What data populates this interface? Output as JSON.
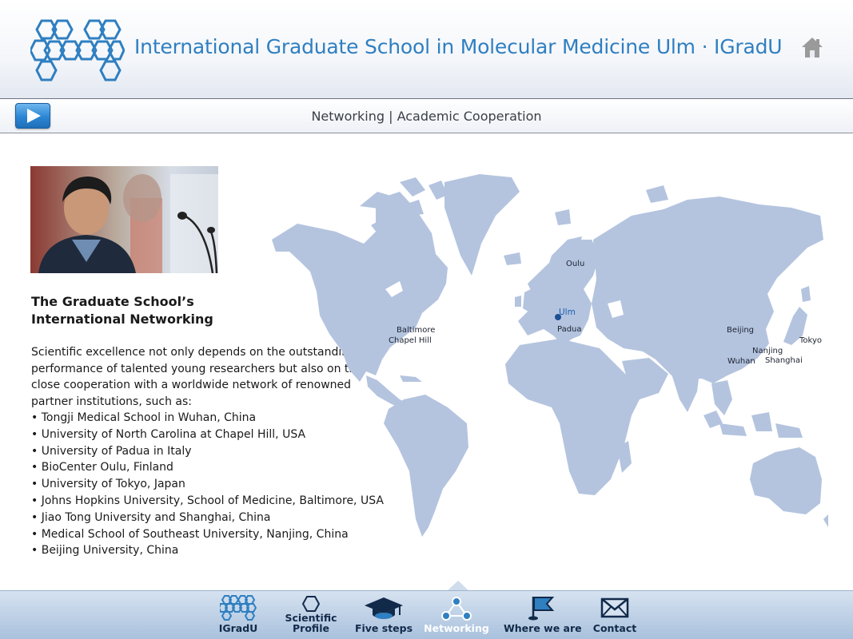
{
  "header": {
    "title": "International Graduate School in Molecular Medicine Ulm · IGradU",
    "logo_icon": "hexagon-logo-icon",
    "home_icon": "home-icon"
  },
  "subbar": {
    "play_icon": "play-icon",
    "breadcrumb": "Networking | Academic Cooperation"
  },
  "content": {
    "heading_line1": "The Graduate School’s",
    "heading_line2": "International Networking",
    "intro": "Scientific excellence not only depends on the outstanding performance of talented young researchers but also on the close cooperation with a worldwide network of renowned partner institutions, such as:",
    "partners": [
      "Tongji Medical School in Wuhan, China",
      "University of North Carolina at Chapel Hill, USA",
      "University of Padua in Italy",
      "BioCenter Oulu, Finland",
      "University of Tokyo, Japan",
      "Johns Hopkins University, School of Medicine, Baltimore, USA",
      "Jiao Tong University and Shanghai, China",
      "Medical School of Southeast University, Nanjing, China",
      "Beijing University, China"
    ]
  },
  "map": {
    "land_color": "#b4c4df",
    "highlight_color": "#1d5fae",
    "cities": {
      "oulu": "Oulu",
      "ulm": "Ulm",
      "padua": "Padua",
      "baltimore": "Baltimore",
      "chapel_hill": "Chapel Hill",
      "beijing": "Beijing",
      "tokyo": "Tokyo",
      "nanjing": "Nanjing",
      "wuhan": "Wuhan",
      "shanghai": "Shanghai"
    }
  },
  "footer": {
    "active": "Networking",
    "items": [
      {
        "label": "IGradU",
        "icon": "hexagon-logo-icon"
      },
      {
        "label_line1": "Scientific",
        "label_line2": "Profile",
        "icon": "hexagon-icon"
      },
      {
        "label": "Five steps",
        "icon": "graduation-cap-icon"
      },
      {
        "label": "Networking",
        "icon": "network-icon"
      },
      {
        "label": "Where we are",
        "icon": "flag-icon"
      },
      {
        "label": "Contact",
        "icon": "envelope-icon"
      }
    ]
  }
}
